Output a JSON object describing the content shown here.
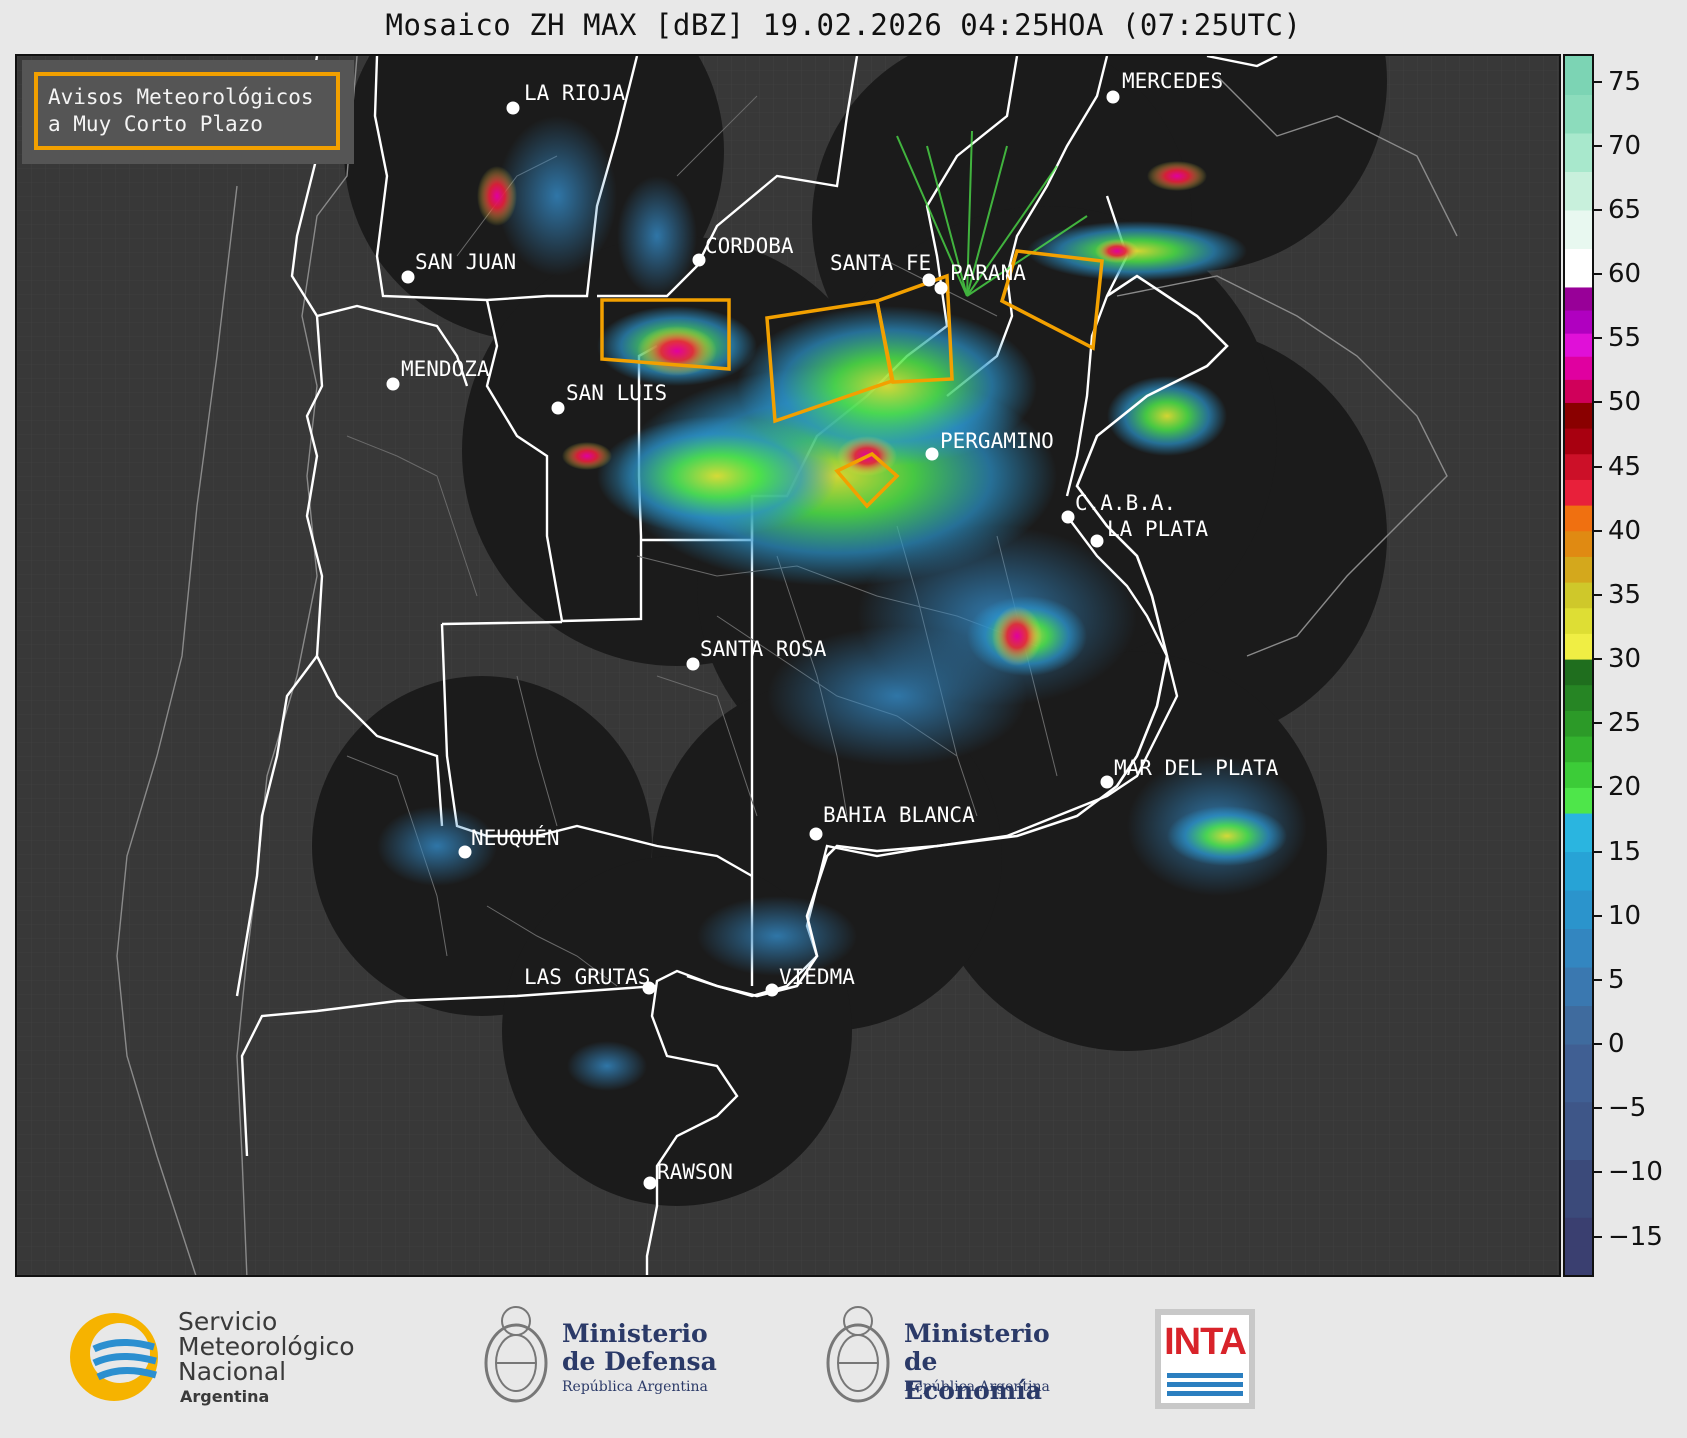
{
  "title": "Mosaico ZH MAX [dBZ] 19.02.2026 04:25HOA (07:25UTC)",
  "warning_legend": {
    "text": "Avisos Meteorológicos\na Muy Corto Plazo",
    "border_color": "#f2a000"
  },
  "cities": [
    {
      "name": "LA RIOJA"
    },
    {
      "name": "MERCEDES"
    },
    {
      "name": "CORDOBA"
    },
    {
      "name": "SAN JUAN"
    },
    {
      "name": "SANTA FE"
    },
    {
      "name": "PARANA"
    },
    {
      "name": "MENDOZA"
    },
    {
      "name": "SAN LUIS"
    },
    {
      "name": "PERGAMINO"
    },
    {
      "name": "C.A.B.A."
    },
    {
      "name": "LA PLATA"
    },
    {
      "name": "SANTA ROSA"
    },
    {
      "name": "MAR DEL PLATA"
    },
    {
      "name": "BAHIA BLANCA"
    },
    {
      "name": "NEUQUÉN"
    },
    {
      "name": "LAS GRUTAS"
    },
    {
      "name": "VIEDMA"
    },
    {
      "name": "RAWSON"
    }
  ],
  "colorbar": {
    "unit": "dBZ",
    "min": -18,
    "max": 77,
    "ticks": [
      "75",
      "70",
      "65",
      "60",
      "55",
      "50",
      "45",
      "40",
      "35",
      "30",
      "25",
      "20",
      "15",
      "10",
      "5",
      "0",
      "−5",
      "−10",
      "−15"
    ],
    "tick_values": [
      75,
      70,
      65,
      60,
      55,
      50,
      45,
      40,
      35,
      30,
      25,
      20,
      15,
      10,
      5,
      0,
      -5,
      -10,
      -15
    ],
    "color_stops": [
      {
        "from": -18,
        "to": 0,
        "colors": [
          "#3a3f70",
          "#3b4a7a",
          "#3e5688",
          "#405f93"
        ]
      },
      {
        "from": 0,
        "to": 18,
        "colors": [
          "#3f6b9e",
          "#3a78b0",
          "#3386c0",
          "#2b94cc",
          "#27a3d6",
          "#2ab5e0"
        ]
      },
      {
        "from": 18,
        "to": 30,
        "colors": [
          "#4ee64a",
          "#3ccc38",
          "#33b22e",
          "#2c9a28",
          "#268524",
          "#1f6e1e"
        ]
      },
      {
        "from": 30,
        "to": 42,
        "colors": [
          "#f0ee44",
          "#dede34",
          "#cfc82a",
          "#d4a81c",
          "#e08a12",
          "#f07010"
        ]
      },
      {
        "from": 42,
        "to": 50,
        "colors": [
          "#e8203a",
          "#cc1028",
          "#a80010",
          "#8a0000"
        ]
      },
      {
        "from": 50,
        "to": 59,
        "colors": [
          "#d0005a",
          "#e000a0",
          "#e010d8",
          "#b000c0",
          "#980098"
        ]
      },
      {
        "from": 59,
        "to": 77,
        "colors": [
          "#ffffff",
          "#e8f8f0",
          "#c8f0dc",
          "#a8e8cc",
          "#8cdcbc",
          "#7cd4b4"
        ]
      }
    ]
  },
  "logos": {
    "smn": {
      "line1": "Servicio",
      "line2": "Meteorológico",
      "line3": "Nacional",
      "line4": "Argentina"
    },
    "defensa": {
      "line1": "Ministerio",
      "line2": "de Defensa",
      "line3": "República Argentina"
    },
    "economia": {
      "line1": "Ministerio",
      "line2": "de Economía",
      "line3": "República Argentina"
    },
    "inta": {
      "text": "INTA"
    }
  }
}
